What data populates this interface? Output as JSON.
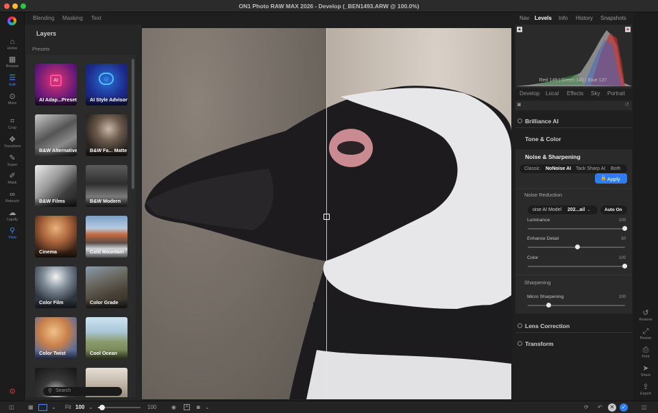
{
  "window": {
    "title": "ON1 Photo RAW MAX 2026 - Develop (_BEN1493.ARW @ 100.0%)"
  },
  "rail": {
    "items": [
      {
        "icon": "home-icon",
        "label": "Home"
      },
      {
        "icon": "browse-icon",
        "label": "Browse"
      },
      {
        "icon": "edit-icon",
        "label": "Edit"
      },
      {
        "icon": "more-icon",
        "label": "More"
      },
      {
        "icon": "crop-icon",
        "label": "Crop"
      },
      {
        "icon": "transform-icon",
        "label": "Transform"
      },
      {
        "icon": "super-icon",
        "label": "Super"
      },
      {
        "icon": "mask-icon",
        "label": "Mask"
      },
      {
        "icon": "retouch-icon",
        "label": "Retouch"
      },
      {
        "icon": "liquify-icon",
        "label": "Liquify"
      },
      {
        "icon": "view-icon",
        "label": "View"
      }
    ],
    "active": "Edit"
  },
  "top_tabs": [
    "Blending",
    "Masking",
    "Text"
  ],
  "left_panel": {
    "title": "Layers",
    "subtitle": "Presets",
    "presets": [
      "AI Adap...Preset",
      "AI Style Advisor",
      "B&W Alternative",
      "B&W Fa... Matte",
      "B&W Films",
      "B&W Modern",
      "Cinema",
      "Cold Mountain",
      "Color Film",
      "Color Grade",
      "Color Twist",
      "Cool Ocean"
    ],
    "search_placeholder": "Search"
  },
  "right_panel": {
    "tabs": [
      "Nav",
      "Levels",
      "Info",
      "History",
      "Snapshots"
    ],
    "active_tab": "Levels",
    "histogram_readout": "Red 149 | Green 140 | Blue 137",
    "subtabs": [
      "Develop",
      "Local",
      "Effects",
      "Sky",
      "Portrait"
    ],
    "sections": {
      "brilliance": "Brilliance AI",
      "tone": "Tone & Color",
      "noise": "Noise & Sharpening",
      "lens": "Lens Correction",
      "transform": "Transform"
    },
    "noise_modes": [
      "Classic",
      "NoNoise AI",
      "Tack Sharp AI",
      "Both"
    ],
    "noise_mode_selected": "NoNoise AI",
    "apply_label": "Apply",
    "noise_reduction_label": "Noise Reduction",
    "model_label": "oise AI Model",
    "model_value": "202...ail",
    "auto_on_label": "Auto On",
    "sliders": [
      {
        "label": "Luminance",
        "value": 100
      },
      {
        "label": "Enhance Detail",
        "value": 50
      },
      {
        "label": "Color",
        "value": 100
      }
    ],
    "sharpening_label": "Sharpening",
    "micro_sharpening": {
      "label": "Micro Sharpening",
      "value": 100
    }
  },
  "side_rail": [
    "Restore",
    "Resize",
    "Print",
    "Share",
    "Export"
  ],
  "bottom": {
    "fit_label": "Fit",
    "fit_value": "100",
    "zoom_value": "100",
    "zoom_fraction": 0.1
  }
}
